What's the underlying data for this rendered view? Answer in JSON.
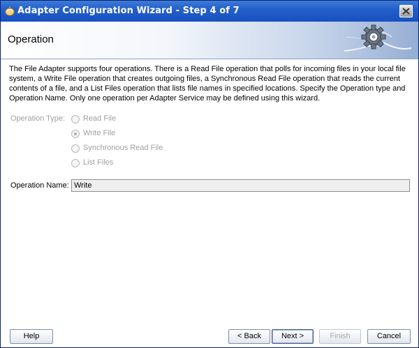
{
  "window": {
    "title": "Adapter Configuration Wizard - Step 4 of 7"
  },
  "banner": {
    "title": "Operation"
  },
  "description": "The File Adapter supports four operations.  There is a Read File operation that polls for incoming files in your local file system, a Write File operation that creates outgoing files, a Synchronous Read File operation that reads the current contents of a file, and a List Files operation that lists file names in specified locations.  Specify the Operation type and Operation Name.  Only one operation per Adapter Service may be defined using this wizard.",
  "operation_type": {
    "label": "Operation Type:",
    "options": [
      {
        "label": "Read File",
        "selected": false
      },
      {
        "label": "Write File",
        "selected": true
      },
      {
        "label": "Synchronous Read File",
        "selected": false
      },
      {
        "label": "List Files",
        "selected": false
      }
    ]
  },
  "operation_name": {
    "label": "Operation Name:",
    "value": "Write"
  },
  "buttons": {
    "help": "Help",
    "back": "< Back",
    "next": "Next >",
    "finish": "Finish",
    "cancel": "Cancel"
  }
}
